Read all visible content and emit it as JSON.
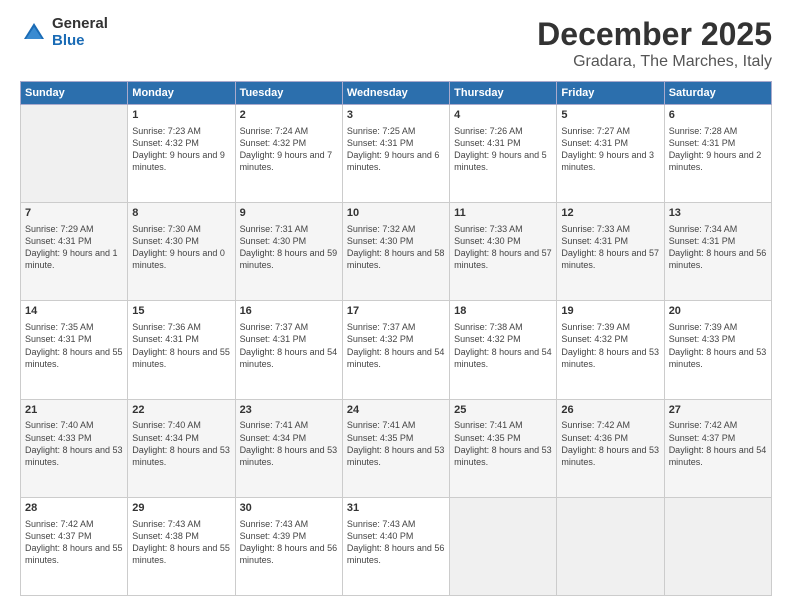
{
  "logo": {
    "general": "General",
    "blue": "Blue"
  },
  "header": {
    "title": "December 2025",
    "subtitle": "Gradara, The Marches, Italy"
  },
  "weekdays": [
    "Sunday",
    "Monday",
    "Tuesday",
    "Wednesday",
    "Thursday",
    "Friday",
    "Saturday"
  ],
  "weeks": [
    [
      {
        "day": "",
        "sunrise": "",
        "sunset": "",
        "daylight": ""
      },
      {
        "day": "1",
        "sunrise": "Sunrise: 7:23 AM",
        "sunset": "Sunset: 4:32 PM",
        "daylight": "Daylight: 9 hours and 9 minutes."
      },
      {
        "day": "2",
        "sunrise": "Sunrise: 7:24 AM",
        "sunset": "Sunset: 4:32 PM",
        "daylight": "Daylight: 9 hours and 7 minutes."
      },
      {
        "day": "3",
        "sunrise": "Sunrise: 7:25 AM",
        "sunset": "Sunset: 4:31 PM",
        "daylight": "Daylight: 9 hours and 6 minutes."
      },
      {
        "day": "4",
        "sunrise": "Sunrise: 7:26 AM",
        "sunset": "Sunset: 4:31 PM",
        "daylight": "Daylight: 9 hours and 5 minutes."
      },
      {
        "day": "5",
        "sunrise": "Sunrise: 7:27 AM",
        "sunset": "Sunset: 4:31 PM",
        "daylight": "Daylight: 9 hours and 3 minutes."
      },
      {
        "day": "6",
        "sunrise": "Sunrise: 7:28 AM",
        "sunset": "Sunset: 4:31 PM",
        "daylight": "Daylight: 9 hours and 2 minutes."
      }
    ],
    [
      {
        "day": "7",
        "sunrise": "Sunrise: 7:29 AM",
        "sunset": "Sunset: 4:31 PM",
        "daylight": "Daylight: 9 hours and 1 minute."
      },
      {
        "day": "8",
        "sunrise": "Sunrise: 7:30 AM",
        "sunset": "Sunset: 4:30 PM",
        "daylight": "Daylight: 9 hours and 0 minutes."
      },
      {
        "day": "9",
        "sunrise": "Sunrise: 7:31 AM",
        "sunset": "Sunset: 4:30 PM",
        "daylight": "Daylight: 8 hours and 59 minutes."
      },
      {
        "day": "10",
        "sunrise": "Sunrise: 7:32 AM",
        "sunset": "Sunset: 4:30 PM",
        "daylight": "Daylight: 8 hours and 58 minutes."
      },
      {
        "day": "11",
        "sunrise": "Sunrise: 7:33 AM",
        "sunset": "Sunset: 4:30 PM",
        "daylight": "Daylight: 8 hours and 57 minutes."
      },
      {
        "day": "12",
        "sunrise": "Sunrise: 7:33 AM",
        "sunset": "Sunset: 4:31 PM",
        "daylight": "Daylight: 8 hours and 57 minutes."
      },
      {
        "day": "13",
        "sunrise": "Sunrise: 7:34 AM",
        "sunset": "Sunset: 4:31 PM",
        "daylight": "Daylight: 8 hours and 56 minutes."
      }
    ],
    [
      {
        "day": "14",
        "sunrise": "Sunrise: 7:35 AM",
        "sunset": "Sunset: 4:31 PM",
        "daylight": "Daylight: 8 hours and 55 minutes."
      },
      {
        "day": "15",
        "sunrise": "Sunrise: 7:36 AM",
        "sunset": "Sunset: 4:31 PM",
        "daylight": "Daylight: 8 hours and 55 minutes."
      },
      {
        "day": "16",
        "sunrise": "Sunrise: 7:37 AM",
        "sunset": "Sunset: 4:31 PM",
        "daylight": "Daylight: 8 hours and 54 minutes."
      },
      {
        "day": "17",
        "sunrise": "Sunrise: 7:37 AM",
        "sunset": "Sunset: 4:32 PM",
        "daylight": "Daylight: 8 hours and 54 minutes."
      },
      {
        "day": "18",
        "sunrise": "Sunrise: 7:38 AM",
        "sunset": "Sunset: 4:32 PM",
        "daylight": "Daylight: 8 hours and 54 minutes."
      },
      {
        "day": "19",
        "sunrise": "Sunrise: 7:39 AM",
        "sunset": "Sunset: 4:32 PM",
        "daylight": "Daylight: 8 hours and 53 minutes."
      },
      {
        "day": "20",
        "sunrise": "Sunrise: 7:39 AM",
        "sunset": "Sunset: 4:33 PM",
        "daylight": "Daylight: 8 hours and 53 minutes."
      }
    ],
    [
      {
        "day": "21",
        "sunrise": "Sunrise: 7:40 AM",
        "sunset": "Sunset: 4:33 PM",
        "daylight": "Daylight: 8 hours and 53 minutes."
      },
      {
        "day": "22",
        "sunrise": "Sunrise: 7:40 AM",
        "sunset": "Sunset: 4:34 PM",
        "daylight": "Daylight: 8 hours and 53 minutes."
      },
      {
        "day": "23",
        "sunrise": "Sunrise: 7:41 AM",
        "sunset": "Sunset: 4:34 PM",
        "daylight": "Daylight: 8 hours and 53 minutes."
      },
      {
        "day": "24",
        "sunrise": "Sunrise: 7:41 AM",
        "sunset": "Sunset: 4:35 PM",
        "daylight": "Daylight: 8 hours and 53 minutes."
      },
      {
        "day": "25",
        "sunrise": "Sunrise: 7:41 AM",
        "sunset": "Sunset: 4:35 PM",
        "daylight": "Daylight: 8 hours and 53 minutes."
      },
      {
        "day": "26",
        "sunrise": "Sunrise: 7:42 AM",
        "sunset": "Sunset: 4:36 PM",
        "daylight": "Daylight: 8 hours and 53 minutes."
      },
      {
        "day": "27",
        "sunrise": "Sunrise: 7:42 AM",
        "sunset": "Sunset: 4:37 PM",
        "daylight": "Daylight: 8 hours and 54 minutes."
      }
    ],
    [
      {
        "day": "28",
        "sunrise": "Sunrise: 7:42 AM",
        "sunset": "Sunset: 4:37 PM",
        "daylight": "Daylight: 8 hours and 55 minutes."
      },
      {
        "day": "29",
        "sunrise": "Sunrise: 7:43 AM",
        "sunset": "Sunset: 4:38 PM",
        "daylight": "Daylight: 8 hours and 55 minutes."
      },
      {
        "day": "30",
        "sunrise": "Sunrise: 7:43 AM",
        "sunset": "Sunset: 4:39 PM",
        "daylight": "Daylight: 8 hours and 56 minutes."
      },
      {
        "day": "31",
        "sunrise": "Sunrise: 7:43 AM",
        "sunset": "Sunset: 4:40 PM",
        "daylight": "Daylight: 8 hours and 56 minutes."
      },
      {
        "day": "",
        "sunrise": "",
        "sunset": "",
        "daylight": ""
      },
      {
        "day": "",
        "sunrise": "",
        "sunset": "",
        "daylight": ""
      },
      {
        "day": "",
        "sunrise": "",
        "sunset": "",
        "daylight": ""
      }
    ]
  ]
}
